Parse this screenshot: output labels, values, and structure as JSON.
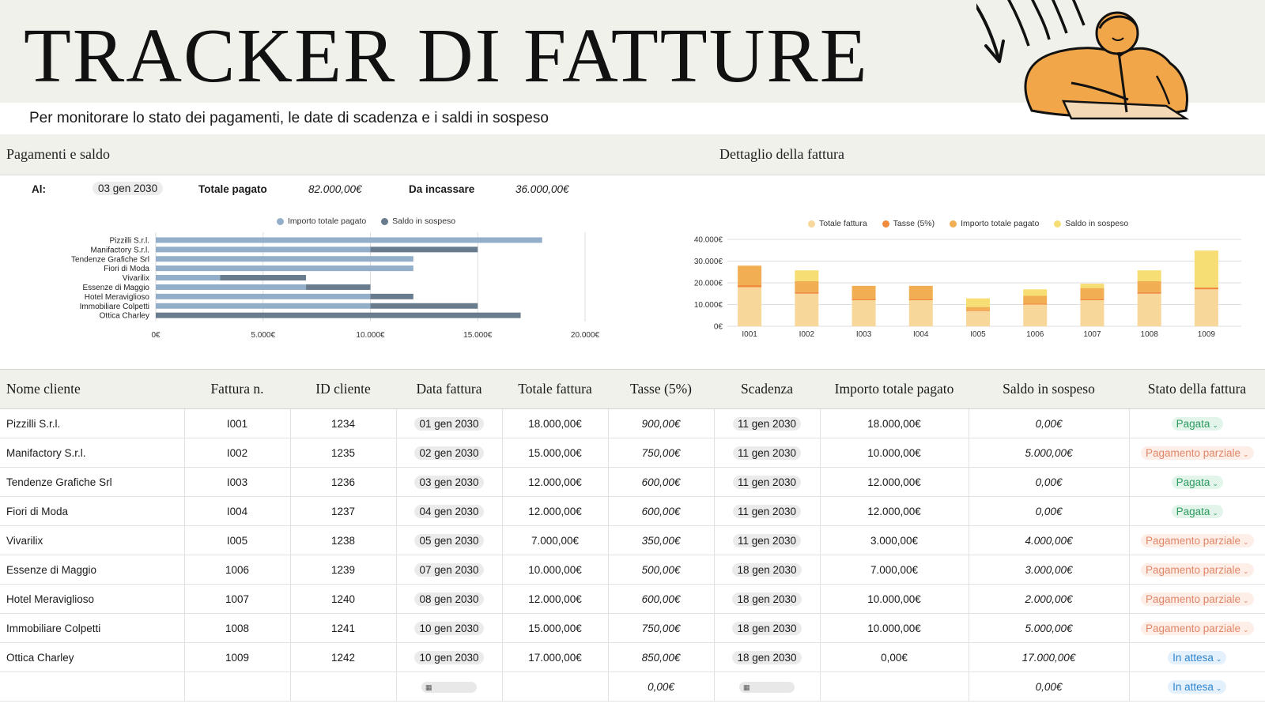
{
  "header": {
    "title": "TRACKER DI FATTURE",
    "subtitle": "Per monitorare lo stato dei pagamenti, le date di scadenza e i saldi in sospeso"
  },
  "sections": {
    "left_title": "Pagamenti e saldo",
    "right_title": "Dettaglio della fattura"
  },
  "summary": {
    "as_of_label": "Al:",
    "as_of_date": "03 gen 2030",
    "paid_label": "Totale pagato",
    "paid_value": "82.000,00€",
    "due_label": "Da incassare",
    "due_value": "36.000,00€"
  },
  "colors": {
    "paid_bar": "#93aec8",
    "balance_bar": "#687c8e",
    "invoice_total": "#f7d79a",
    "tax": "#f08a3c",
    "paid_stack": "#f2ae52",
    "balance_stack": "#f6de74",
    "status_paid": "#2e9b61",
    "status_paid_bg": "#e3f5ea",
    "status_partial": "#e0876a",
    "status_partial_bg": "#fdeee8",
    "status_waiting": "#2f86d0",
    "status_waiting_bg": "#e4f0fb",
    "illustration": "#f2a64a"
  },
  "chart_data": [
    {
      "type": "bar",
      "orientation": "horizontal",
      "stacked": true,
      "categories": [
        "Pizzilli S.r.l.",
        "Manifactory S.r.l.",
        "Tendenze Grafiche Srl",
        "Fiori di Moda",
        "Vivarilix",
        "Essenze di Maggio",
        "Hotel Meraviglioso",
        "Immobiliare Colpetti",
        "Ottica Charley"
      ],
      "series": [
        {
          "name": "Importo totale pagato",
          "values": [
            18000,
            10000,
            12000,
            12000,
            3000,
            7000,
            10000,
            10000,
            0
          ]
        },
        {
          "name": "Saldo in sospeso",
          "values": [
            0,
            5000,
            0,
            0,
            4000,
            3000,
            2000,
            5000,
            17000
          ]
        }
      ],
      "xlim": [
        0,
        20000
      ],
      "x_ticks": [
        "0€",
        "5.000€",
        "10.000€",
        "15.000€",
        "20.000€"
      ],
      "x_tick_values": [
        0,
        5000,
        10000,
        15000,
        20000
      ],
      "legend": "top",
      "grid": true
    },
    {
      "type": "bar",
      "stacked": true,
      "categories": [
        "I001",
        "I002",
        "I003",
        "I004",
        "I005",
        "1006",
        "1007",
        "1008",
        "1009"
      ],
      "series": [
        {
          "name": "Totale fattura",
          "values": [
            18000,
            15000,
            12000,
            12000,
            7000,
            10000,
            12000,
            15000,
            17000
          ]
        },
        {
          "name": "Tasse (5%)",
          "values": [
            900,
            750,
            600,
            600,
            350,
            500,
            600,
            750,
            850
          ]
        },
        {
          "name": "Importo totale pagato",
          "values": [
            18000,
            10000,
            12000,
            12000,
            3000,
            7000,
            10000,
            10000,
            0
          ]
        },
        {
          "name": "Saldo in sospeso",
          "values": [
            0,
            5000,
            0,
            0,
            4000,
            3000,
            2000,
            5000,
            17000
          ]
        }
      ],
      "ylim": [
        0,
        40000
      ],
      "y_ticks": [
        "0€",
        "10.000€",
        "20.000€",
        "30.000€",
        "40.000€"
      ],
      "y_tick_values": [
        0,
        10000,
        20000,
        30000,
        40000
      ],
      "legend": "top",
      "grid": true
    }
  ],
  "table": {
    "headers": [
      "Nome cliente",
      "Fattura n.",
      "ID cliente",
      "Data fattura",
      "Totale fattura",
      "Tasse (5%)",
      "Scadenza",
      "Importo totale pagato",
      "Saldo in sospeso",
      "Stato della fattura"
    ],
    "rows": [
      {
        "client": "Pizzilli S.r.l.",
        "invoice": "I001",
        "client_id": "1234",
        "date": "01 gen 2030",
        "total": "18.000,00€",
        "tax": "900,00€",
        "due": "11 gen 2030",
        "paid": "18.000,00€",
        "balance": "0,00€",
        "status": "Pagata",
        "status_kind": "paid"
      },
      {
        "client": "Manifactory S.r.l.",
        "invoice": "I002",
        "client_id": "1235",
        "date": "02 gen 2030",
        "total": "15.000,00€",
        "tax": "750,00€",
        "due": "11 gen 2030",
        "paid": "10.000,00€",
        "balance": "5.000,00€",
        "status": "Pagamento parziale",
        "status_kind": "partial"
      },
      {
        "client": "Tendenze Grafiche Srl",
        "invoice": "I003",
        "client_id": "1236",
        "date": "03 gen 2030",
        "total": "12.000,00€",
        "tax": "600,00€",
        "due": "11 gen 2030",
        "paid": "12.000,00€",
        "balance": "0,00€",
        "status": "Pagata",
        "status_kind": "paid"
      },
      {
        "client": "Fiori di Moda",
        "invoice": "I004",
        "client_id": "1237",
        "date": "04 gen 2030",
        "total": "12.000,00€",
        "tax": "600,00€",
        "due": "11 gen 2030",
        "paid": "12.000,00€",
        "balance": "0,00€",
        "status": "Pagata",
        "status_kind": "paid"
      },
      {
        "client": "Vivarilix",
        "invoice": "I005",
        "client_id": "1238",
        "date": "05 gen 2030",
        "total": "7.000,00€",
        "tax": "350,00€",
        "due": "11 gen 2030",
        "paid": "3.000,00€",
        "balance": "4.000,00€",
        "status": "Pagamento parziale",
        "status_kind": "partial"
      },
      {
        "client": "Essenze di Maggio",
        "invoice": "1006",
        "client_id": "1239",
        "date": "07 gen 2030",
        "total": "10.000,00€",
        "tax": "500,00€",
        "due": "18 gen 2030",
        "paid": "7.000,00€",
        "balance": "3.000,00€",
        "status": "Pagamento parziale",
        "status_kind": "partial"
      },
      {
        "client": "Hotel Meraviglioso",
        "invoice": "1007",
        "client_id": "1240",
        "date": "08 gen 2030",
        "total": "12.000,00€",
        "tax": "600,00€",
        "due": "18 gen 2030",
        "paid": "10.000,00€",
        "balance": "2.000,00€",
        "status": "Pagamento parziale",
        "status_kind": "partial"
      },
      {
        "client": "Immobiliare Colpetti",
        "invoice": "1008",
        "client_id": "1241",
        "date": "10 gen 2030",
        "total": "15.000,00€",
        "tax": "750,00€",
        "due": "18 gen 2030",
        "paid": "10.000,00€",
        "balance": "5.000,00€",
        "status": "Pagamento parziale",
        "status_kind": "partial"
      },
      {
        "client": "Ottica Charley",
        "invoice": "1009",
        "client_id": "1242",
        "date": "10 gen 2030",
        "total": "17.000,00€",
        "tax": "850,00€",
        "due": "18 gen 2030",
        "paid": "0,00€",
        "balance": "17.000,00€",
        "status": "In attesa",
        "status_kind": "waiting"
      },
      {
        "client": "",
        "invoice": "",
        "client_id": "",
        "date": "",
        "total": "",
        "tax": "0,00€",
        "due": "",
        "paid": "",
        "balance": "0,00€",
        "status": "In attesa",
        "status_kind": "waiting"
      }
    ]
  }
}
